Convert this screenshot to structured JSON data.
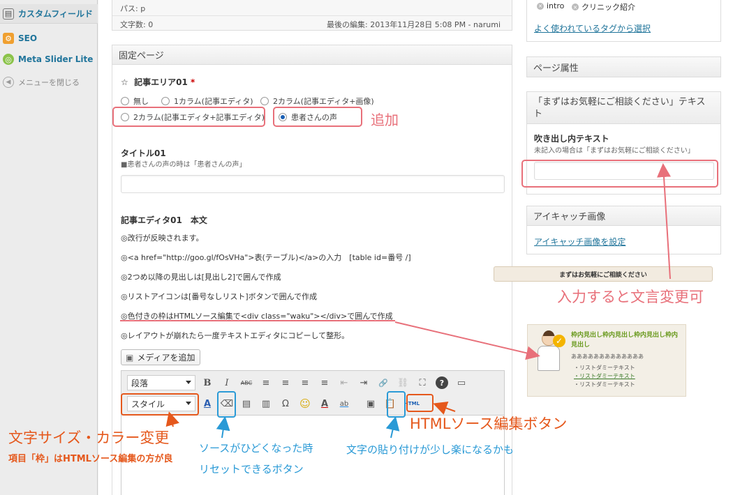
{
  "sidebar": {
    "items": [
      {
        "label": "カスタムフィールド"
      },
      {
        "label": "SEO"
      },
      {
        "label": "Meta Slider Lite"
      },
      {
        "label": "メニューを閉じる"
      }
    ]
  },
  "editor_status": {
    "path": "パス: p",
    "word_count": "文字数: 0",
    "last_edit": "最後の編集: 2013年11月28日 5:08 PM - narumi"
  },
  "fixed_page": {
    "title": "固定ページ",
    "area_title": "記事エリア01",
    "area_required": "*",
    "radio_options": [
      {
        "label": "無し",
        "checked": false
      },
      {
        "label": "1カラム(記事エディタ)",
        "checked": false
      },
      {
        "label": "2カラム(記事エディタ+画像)",
        "checked": false
      },
      {
        "label": "2カラム(記事エディタ+記事エディタ)",
        "checked": false
      },
      {
        "label": "患者さんの声",
        "checked": true
      }
    ],
    "title01_label": "タイトル01",
    "title01_note": "■患者さんの声の時は「患者さんの声」",
    "title01_value": "",
    "editor_label": "記事エディタ01　本文",
    "body_lines": [
      "◎改行が反映されます。",
      "◎<a href=\"http://goo.gl/fOsVHa\">表(テーブル)</a>の入力　[table id=番号 /]",
      "◎2つめ以降の見出しは[見出し2]で囲んで作成",
      "◎リストアイコンは[番号なしリスト]ボタンで囲んで作成",
      "◎色付きの枠はHTMLソース編集で<div class=\"waku\"></div>で囲んで作成",
      "◎レイアウトが崩れたら一度テキストエディタにコピーして整形。"
    ],
    "media_button": "メディアを追加",
    "toolbar": {
      "format_select": "段落",
      "style_select": "スタイル",
      "html_button": "HTML",
      "buttons_row1": [
        "B",
        "I",
        "ABC",
        "≡",
        "≡",
        "≡",
        "≡",
        "⇤",
        "⇥",
        "🔗",
        "⛓",
        "⛶",
        "?",
        "▭"
      ],
      "buttons_row2": [
        "A",
        "⌫",
        "▤",
        "▥",
        "Ω",
        "☺",
        "A",
        "ab",
        "▣",
        "📋"
      ]
    }
  },
  "tags": {
    "items": [
      "intro",
      "クリニック紹介"
    ],
    "choose_link": "よく使われているタグから選択"
  },
  "page_attributes": {
    "title": "ページ属性"
  },
  "fukidashi_box": {
    "title": "「まずはお気軽にご相談ください」テキスト",
    "field_label": "吹き出し内テキスト",
    "field_note": "未記入の場合は「まずはお気軽にご相談ください」",
    "field_value": ""
  },
  "eyecatch": {
    "title": "アイキャッチ画像",
    "link": "アイキャッチ画像を設定"
  },
  "balloon_preview": {
    "text": "まずはお気軽にご相談ください"
  },
  "waku_preview": {
    "heading": "枠内見出し枠内見出し枠内見出し枠内見出し",
    "text": "あああああああああああああ",
    "list": [
      "リストダミーテキスト",
      "リストダミーテキスト",
      "リストダミーテキスト"
    ]
  },
  "annotations": {
    "add": "追加",
    "input_change": "入力すると文言変更可",
    "html_source_button": "HTMLソース編集ボタン",
    "font_size_color": "文字サイズ・カラー変更",
    "waku_note": "項目「枠」はHTMLソース編集の方が良",
    "reset_line1": "ソースがひどくなった時",
    "reset_line2": "リセットできるボタン",
    "paste_note": "文字の貼り付けが少し楽になるかも"
  },
  "colors": {
    "annotation_red": "#e8707a",
    "annotation_orange": "#e5581c",
    "annotation_blue": "#2a9ad6",
    "link_blue": "#21759b"
  }
}
